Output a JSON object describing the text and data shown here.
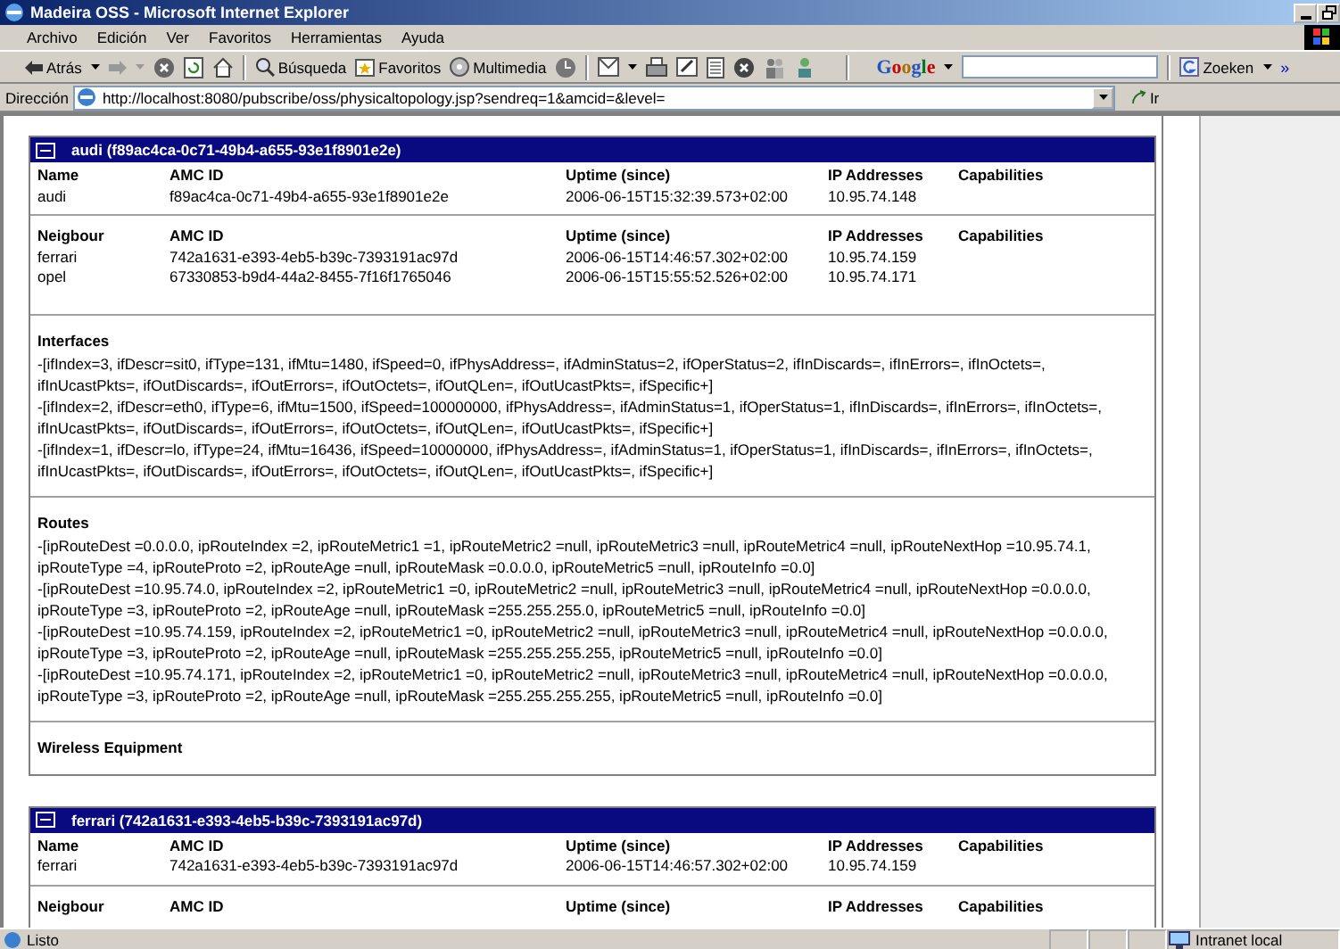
{
  "window": {
    "title": "Madeira OSS - Microsoft Internet Explorer"
  },
  "menu": [
    "Archivo",
    "Edición",
    "Ver",
    "Favoritos",
    "Herramientas",
    "Ayuda"
  ],
  "toolbar": {
    "back": "Atrás",
    "search": "Búsqueda",
    "favorites": "Favoritos",
    "media": "Multimedia",
    "google": "Google",
    "search_button": "Zoeken",
    "more": "»"
  },
  "address": {
    "label": "Dirección",
    "url": "http://localhost:8080/pubscribe/oss/physicaltopology.jsp?sendreq=1&amcid=&level=",
    "go": "Ir"
  },
  "devices": [
    {
      "title": "audi (f89ac4ca-0c71-49b4-a655-93e1f8901e2e)",
      "expanded": true,
      "columns": [
        "Name",
        "AMC ID",
        "Uptime (since)",
        "IP Addresses",
        "Capabilities"
      ],
      "row": [
        "audi",
        "f89ac4ca-0c71-49b4-a655-93e1f8901e2e",
        "2006-06-15T15:32:39.573+02:00",
        "10.95.74.148"
      ],
      "neighbour_columns": [
        "Neigbour",
        "AMC ID",
        "Uptime (since)",
        "IP Addresses",
        "Capabilities"
      ],
      "neighbours": [
        [
          "ferrari",
          "742a1631-e393-4eb5-b39c-7393191ac97d",
          "2006-06-15T14:46:57.302+02:00",
          "10.95.74.159"
        ],
        [
          "opel",
          "67330853-b9d4-44a2-8455-7f16f1765046",
          "2006-06-15T15:55:52.526+02:00",
          "10.95.74.171"
        ]
      ],
      "interfaces_title": "Interfaces",
      "interfaces": [
        "-[ifIndex=3, ifDescr=sit0, ifType=131, ifMtu=1480, ifSpeed=0, ifPhysAddress=, ifAdminStatus=2, ifOperStatus=2, ifInDiscards=, ifInErrors=, ifInOctets=, ifInUcastPkts=, ifOutDiscards=, ifOutErrors=, ifOutOctets=, ifOutQLen=, ifOutUcastPkts=, ifSpecific+]",
        "-[ifIndex=2, ifDescr=eth0, ifType=6, ifMtu=1500, ifSpeed=100000000, ifPhysAddress=, ifAdminStatus=1, ifOperStatus=1, ifInDiscards=, ifInErrors=, ifInOctets=, ifInUcastPkts=, ifOutDiscards=, ifOutErrors=, ifOutOctets=, ifOutQLen=, ifOutUcastPkts=, ifSpecific+]",
        "-[ifIndex=1, ifDescr=lo, ifType=24, ifMtu=16436, ifSpeed=10000000, ifPhysAddress=, ifAdminStatus=1, ifOperStatus=1, ifInDiscards=, ifInErrors=, ifInOctets=, ifInUcastPkts=, ifOutDiscards=, ifOutErrors=, ifOutOctets=, ifOutQLen=, ifOutUcastPkts=, ifSpecific+]"
      ],
      "routes_title": "Routes",
      "routes": [
        "-[ipRouteDest =0.0.0.0, ipRouteIndex =2, ipRouteMetric1 =1, ipRouteMetric2 =null, ipRouteMetric3 =null, ipRouteMetric4 =null, ipRouteNextHop =10.95.74.1, ipRouteType =4, ipRouteProto =2, ipRouteAge =null, ipRouteMask =0.0.0.0, ipRouteMetric5 =null, ipRouteInfo =0.0]",
        "-[ipRouteDest =10.95.74.0, ipRouteIndex =2, ipRouteMetric1 =0, ipRouteMetric2 =null, ipRouteMetric3 =null, ipRouteMetric4 =null, ipRouteNextHop =0.0.0.0, ipRouteType =3, ipRouteProto =2, ipRouteAge =null, ipRouteMask =255.255.255.0, ipRouteMetric5 =null, ipRouteInfo =0.0]",
        "-[ipRouteDest =10.95.74.159, ipRouteIndex =2, ipRouteMetric1 =0, ipRouteMetric2 =null, ipRouteMetric3 =null, ipRouteMetric4 =null, ipRouteNextHop =0.0.0.0, ipRouteType =3, ipRouteProto =2, ipRouteAge =null, ipRouteMask =255.255.255.255, ipRouteMetric5 =null, ipRouteInfo =0.0]",
        "-[ipRouteDest =10.95.74.171, ipRouteIndex =2, ipRouteMetric1 =0, ipRouteMetric2 =null, ipRouteMetric3 =null, ipRouteMetric4 =null, ipRouteNextHop =0.0.0.0, ipRouteType =3, ipRouteProto =2, ipRouteAge =null, ipRouteMask =255.255.255.255, ipRouteMetric5 =null, ipRouteInfo =0.0]"
      ],
      "wireless_title": "Wireless Equipment"
    },
    {
      "title": "ferrari (742a1631-e393-4eb5-b39c-7393191ac97d)",
      "expanded": true,
      "columns": [
        "Name",
        "AMC ID",
        "Uptime (since)",
        "IP Addresses",
        "Capabilities"
      ],
      "row": [
        "ferrari",
        "742a1631-e393-4eb5-b39c-7393191ac97d",
        "2006-06-15T14:46:57.302+02:00",
        "10.95.74.159"
      ],
      "neighbour_columns": [
        "Neigbour",
        "AMC ID",
        "Uptime (since)",
        "IP Addresses",
        "Capabilities"
      ]
    }
  ],
  "status_bar": {
    "text": "Listo",
    "zone": "Intranet local"
  }
}
